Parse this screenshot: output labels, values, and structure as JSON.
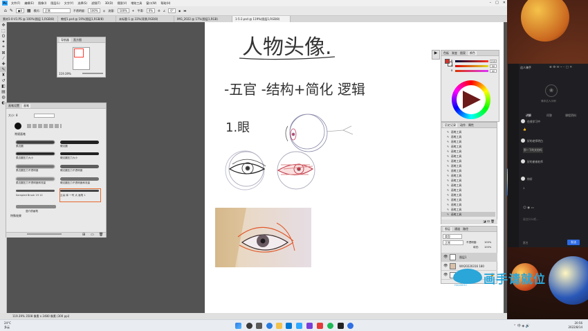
{
  "menubar": {
    "items": [
      "文件(F)",
      "编辑(E)",
      "图像(I)",
      "图层(L)",
      "文字(Y)",
      "选择(S)",
      "滤镜(T)",
      "3D(D)",
      "视图(V)",
      "增效工具",
      "窗口(W)",
      "帮助(H)"
    ],
    "logo": "Ps"
  },
  "options": {
    "mode_label": "模式:",
    "mode_value": "正常",
    "opacity_label": "不透明度:",
    "opacity_value": "100%",
    "flow_label": "流量:",
    "flow_value": "100%",
    "smooth_label": "平滑:",
    "smooth_value": "0%",
    "angle_value": "0°"
  },
  "tabs": [
    {
      "label": "素材1-0-V1.PS @ 100%(图层 1,RGB/8)",
      "active": false
    },
    {
      "label": "教程1.psd @ 19%(图层1,RGB/8)",
      "active": false
    },
    {
      "label": "未标题-1 @ 33%(背景,RGB/8)",
      "active": false
    },
    {
      "label": "IMG_2022 @ 17%(图层1,RGB)",
      "active": false
    },
    {
      "label": "1-5-2.psd @ 119%(图层1,RGB/8)",
      "active": true
    }
  ],
  "navigator": {
    "tabs": [
      "导航器",
      "直方图"
    ],
    "zoom": "119.39%"
  },
  "brushes": {
    "tabs": [
      "画笔设置",
      "画笔"
    ],
    "size_label": "大小:",
    "size_value": "8",
    "group_label": "常规画笔",
    "items": [
      [
        "柔边圆",
        "硬边圆"
      ],
      [
        "柔边圆压力大小",
        "硬边圆压力大小"
      ],
      [
        "柔边圆压力不透明度",
        "硬边圆压力不透明度"
      ],
      [
        "柔边圆压力不透明度和流量",
        "硬边圆压力不透明度和流量"
      ],
      [
        "Sampled Brush 19 12",
        "云朵 库 一号 大 画笔 1"
      ]
    ],
    "footer_group": "湿介质画笔",
    "sub_group": "特殊效果"
  },
  "color_panel": {
    "tabs": [
      "色板",
      "渐变",
      "图案",
      "颜色"
    ],
    "fg": "#d7322a",
    "sliders": [
      {
        "letter": "R",
        "value": "215"
      },
      {
        "letter": "G",
        "value": "50"
      },
      {
        "letter": "B",
        "value": "42"
      }
    ]
  },
  "history": {
    "tabs": [
      "历史记录",
      "动作",
      "属性"
    ],
    "items": [
      "画笔工具",
      "画笔工具",
      "画笔工具",
      "画笔工具",
      "画笔工具",
      "画笔工具",
      "画笔工具",
      "画笔工具",
      "画笔工具",
      "画笔工具",
      "画笔工具",
      "画笔工具",
      "画笔工具",
      "画笔工具",
      "画笔工具",
      "画笔工具",
      "画笔工具",
      "画笔工具"
    ]
  },
  "layers": {
    "tabs": [
      "图层",
      "通道",
      "路径"
    ],
    "kind_label": "类型",
    "blend_value": "正常",
    "opacity_label": "不透明度:",
    "opacity_value": "100%",
    "fill_label": "填充:",
    "fill_value": "100%",
    "rows": [
      {
        "name": "图层1"
      },
      {
        "name": "WX20220316 180"
      },
      {
        "name": "背景"
      }
    ]
  },
  "canvas_text": {
    "title": "人物头像.",
    "line2": "-五官 -结构+简化 逻辑",
    "line3": "1.眼"
  },
  "status": {
    "text": "119.39%   3508 像素 x 2480 像素 (300 ppi)"
  },
  "chat": {
    "header": "达人骑手",
    "room_title": "骑手达人示例",
    "tabs": [
      "讲解",
      "问答",
      "课程资料"
    ],
    "messages": [
      "在线学习中",
      "👍",
      "好的老师明白",
      "那一下的文档吗",
      "好的谢谢老师",
      "你好",
      "1"
    ],
    "input_placeholder": "说点什么吧...",
    "send_label": "发送",
    "anon_label": "匿名"
  },
  "taskbar": {
    "weather_temp": "24°C",
    "weather_desc": "多云",
    "time": "20:56",
    "date": "2022/8/14"
  },
  "watermark": {
    "text": "画手请就位",
    "sub": "HUASHOU"
  }
}
